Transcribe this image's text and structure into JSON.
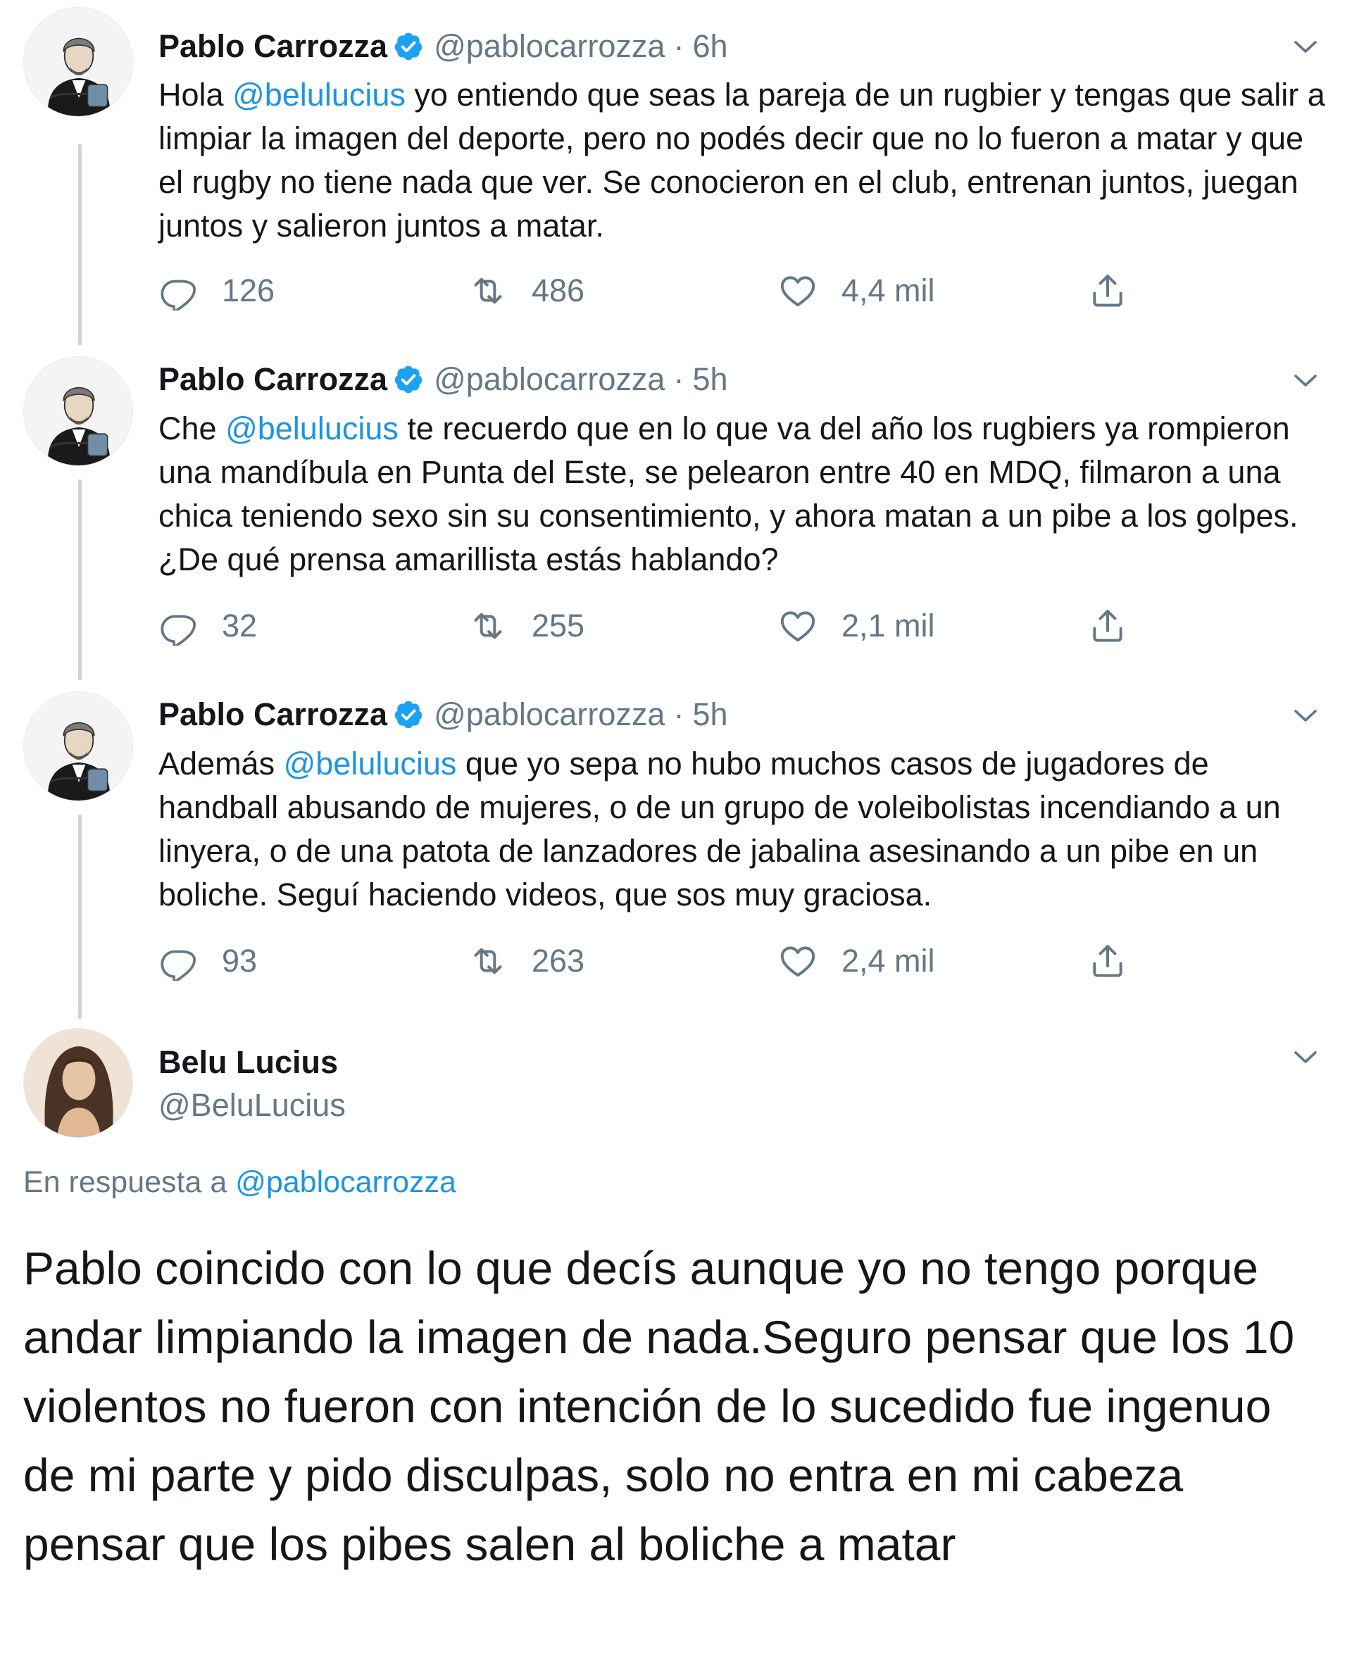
{
  "tweets": [
    {
      "name": "Pablo Carrozza",
      "handle": "@pablocarrozza",
      "time": "6h",
      "pre": "Hola ",
      "mention": "@belulucius",
      "post": " yo entiendo que seas la pareja de un rugbier y tengas que salir a limpiar la imagen del deporte, pero no podés decir que no lo fueron a matar y que el rugby no tiene nada que ver. Se conocieron en el club, entrenan juntos, juegan juntos y salieron juntos a matar.",
      "replies": "126",
      "retweets": "486",
      "likes": "4,4 mil"
    },
    {
      "name": "Pablo Carrozza",
      "handle": "@pablocarrozza",
      "time": "5h",
      "pre": "Che ",
      "mention": "@belulucius",
      "post": " te recuerdo que en lo que va del año los rugbiers ya rompieron una mandíbula en Punta del Este, se pelearon entre 40 en MDQ, filmaron a una chica teniendo sexo sin su consentimiento, y ahora matan a un pibe a los golpes. ¿De qué prensa amarillista estás hablando?",
      "replies": "32",
      "retweets": "255",
      "likes": "2,1 mil"
    },
    {
      "name": "Pablo Carrozza",
      "handle": "@pablocarrozza",
      "time": "5h",
      "pre": "Además ",
      "mention": "@belulucius",
      "post": " que yo sepa no hubo muchos casos de jugadores de handball abusando de mujeres, o de un grupo de voleibolistas incendiando a un linyera, o de una patota de lanzadores de jabalina asesinando a un pibe en un boliche. Seguí haciendo videos, que sos muy graciosa.",
      "replies": "93",
      "retweets": "263",
      "likes": "2,4 mil"
    }
  ],
  "reply": {
    "name": "Belu Lucius",
    "handle": "@BeluLucius",
    "reply_prefix": "En respuesta a ",
    "reply_to": "@pablocarrozza",
    "text": "Pablo coincido con lo que decís aunque yo no tengo porque andar limpiando la imagen de nada.Seguro pensar que los 10 violentos no fueron con intención de lo sucedido fue ingenuo de mi parte y pido disculpas, solo no entra en mi cabeza pensar que los pibes salen al boliche a matar"
  },
  "icons": {
    "verified": "verified-badge-icon",
    "caret": "chevron-down-icon",
    "reply": "reply-icon",
    "retweet": "retweet-icon",
    "like": "heart-icon",
    "share": "share-icon"
  },
  "colors": {
    "text": "#14171a",
    "secondary": "#657786",
    "mention": "#1b95e0",
    "verified": "#1da1f2",
    "thread_line": "#ccd6dd"
  }
}
